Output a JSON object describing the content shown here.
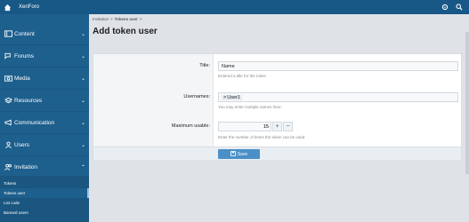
{
  "topbar": {
    "brand": "XenForo"
  },
  "sidebar": {
    "items": [
      {
        "label": "Content",
        "icon": "content-icon"
      },
      {
        "label": "Forums",
        "icon": "forums-icon"
      },
      {
        "label": "Media",
        "icon": "camera-icon"
      },
      {
        "label": "Resources",
        "icon": "resources-icon"
      },
      {
        "label": "Communication",
        "icon": "megaphone-icon"
      },
      {
        "label": "Users",
        "icon": "user-icon"
      },
      {
        "label": "Invitation",
        "icon": "users-icon"
      }
    ],
    "subitems": [
      "Tokens",
      "Tokens user",
      "List code",
      "Banned users"
    ]
  },
  "breadcrumb": {
    "part1": "Invitation",
    "sep1": ">",
    "part2": "Tokens user",
    "sep2": ">"
  },
  "page": {
    "title": "Add token user"
  },
  "form": {
    "title_label": "Title:",
    "title_value": "Name",
    "title_hint": "Entered a title for the token",
    "usernames_label": "Usernames:",
    "usernames_token": "User1",
    "usernames_hint": "You may enter multiple names here.",
    "max_label": "Maximum usable:",
    "max_value": "15",
    "max_hint": "Enter the number of times the token can be used",
    "plus": "+",
    "minus": "−",
    "save_label": "Save"
  }
}
